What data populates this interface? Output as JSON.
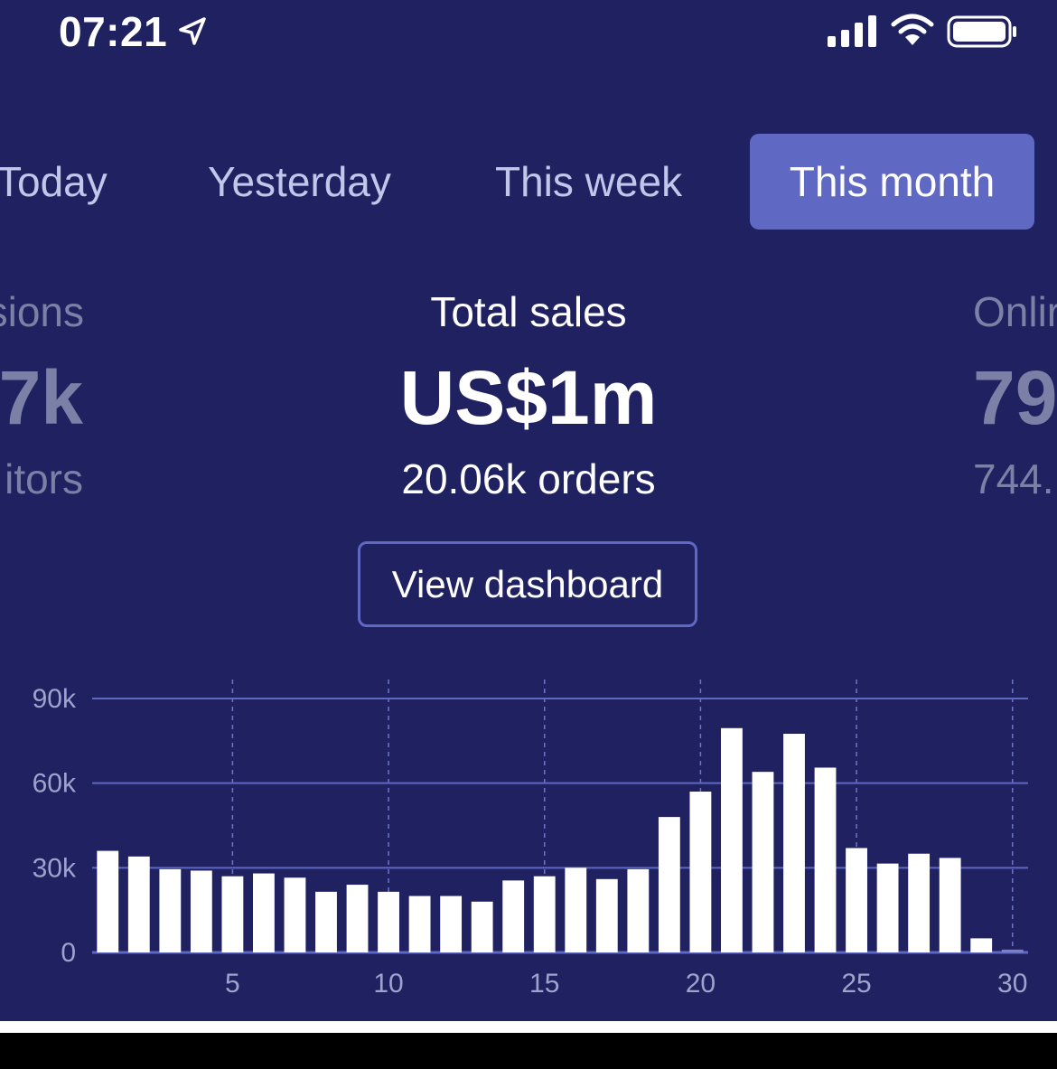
{
  "status_bar": {
    "time": "07:21"
  },
  "tabs": [
    {
      "label": "Today",
      "active": false
    },
    {
      "label": "Yesterday",
      "active": false
    },
    {
      "label": "This week",
      "active": false
    },
    {
      "label": "This month",
      "active": true
    }
  ],
  "stats": {
    "left": {
      "title": "sions",
      "value": "7k",
      "sub": "itors"
    },
    "center": {
      "title": "Total sales",
      "value": "US$1m",
      "sub": "20.06k orders"
    },
    "right": {
      "title": "Onlir",
      "value": "79",
      "sub": "744."
    }
  },
  "view_dashboard_label": "View dashboard",
  "colors": {
    "background": "#1f2160",
    "accent": "#5f68c2",
    "bar": "#ffffff",
    "gridline": "#5f68c2",
    "muted_text": "#7c80a6"
  },
  "chart_data": {
    "type": "bar",
    "x": [
      1,
      2,
      3,
      4,
      5,
      6,
      7,
      8,
      9,
      10,
      11,
      12,
      13,
      14,
      15,
      16,
      17,
      18,
      19,
      20,
      21,
      22,
      23,
      24,
      25,
      26,
      27,
      28,
      29,
      30
    ],
    "values": [
      36000,
      34000,
      29500,
      29000,
      27000,
      28000,
      26500,
      21500,
      24000,
      21500,
      20000,
      20000,
      18000,
      25500,
      27000,
      30000,
      26000,
      29500,
      48000,
      57000,
      79500,
      64000,
      77500,
      65500,
      37000,
      31500,
      35000,
      33500,
      5000,
      1000
    ],
    "xticks": [
      "5",
      "10",
      "15",
      "20",
      "25",
      "30"
    ],
    "xtick_values": [
      5,
      10,
      15,
      20,
      25,
      30
    ],
    "yticks": [
      "0",
      "30k",
      "60k",
      "90k"
    ],
    "ytick_values": [
      0,
      30000,
      60000,
      90000
    ],
    "ylim": [
      0,
      90000
    ],
    "xlim": [
      0.5,
      30.5
    ],
    "grid": true,
    "title": "",
    "xlabel": "",
    "ylabel": ""
  }
}
